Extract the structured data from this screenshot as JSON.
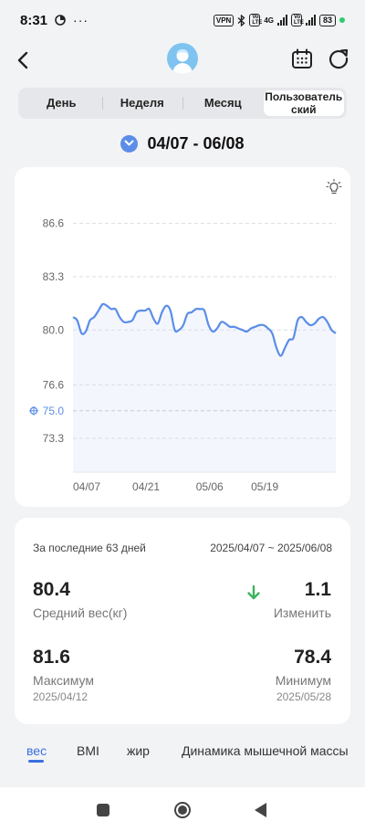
{
  "status_bar": {
    "time": "8:31",
    "vpn": "VPN",
    "net1": "4G",
    "battery": "83",
    "volte": "Vo LTE"
  },
  "header": {
    "icons": [
      "back-arrow-icon",
      "avatar-icon",
      "calendar-icon",
      "refresh-icon"
    ]
  },
  "tabs": [
    "День",
    "Неделя",
    "Месяц",
    "Пользователь ский"
  ],
  "active_tab": 3,
  "range": {
    "text": "04/07 - 06/08"
  },
  "chart_data": {
    "type": "line",
    "yticks": [
      "86.6",
      "83.3",
      "80.0",
      "76.6",
      "73.3"
    ],
    "goal_label": "75.0",
    "goal": 75.0,
    "xticks": [
      "04/07",
      "04/21",
      "05/06",
      "05/19"
    ],
    "ylim": [
      71.2,
      88.5
    ],
    "x": [
      0,
      1,
      2,
      3,
      4,
      5,
      6,
      7,
      8,
      9,
      10,
      11,
      12,
      13,
      14,
      15,
      16,
      17,
      18,
      19,
      20,
      21,
      22,
      23,
      24,
      25,
      26,
      27,
      28,
      29,
      30,
      31,
      32,
      33,
      34,
      35,
      36,
      37,
      38,
      39,
      40,
      41,
      42,
      43,
      44,
      45,
      46,
      47,
      48,
      49,
      50,
      51,
      52,
      53,
      54,
      55,
      56,
      57,
      58,
      59,
      60,
      61,
      62
    ],
    "values": [
      80.8,
      80.6,
      79.8,
      79.9,
      80.6,
      80.8,
      81.2,
      81.6,
      81.5,
      81.3,
      81.3,
      80.8,
      80.5,
      80.5,
      80.6,
      81.1,
      81.2,
      81.2,
      81.3,
      80.7,
      80.4,
      81.1,
      81.5,
      81.2,
      80.0,
      80.0,
      80.3,
      81.0,
      81.1,
      81.3,
      81.3,
      81.2,
      80.3,
      79.9,
      80.1,
      80.5,
      80.4,
      80.2,
      80.2,
      80.1,
      80.0,
      79.9,
      80.1,
      80.2,
      80.3,
      80.3,
      80.1,
      79.8,
      78.9,
      78.4,
      78.9,
      79.4,
      79.5,
      80.6,
      80.8,
      80.5,
      80.3,
      80.4,
      80.7,
      80.8,
      80.5,
      80.0,
      79.8
    ],
    "line_color": "#5b8de8",
    "fill_color": "#f3f6fd"
  },
  "stats": {
    "period_label": "За последние 63 дней",
    "period_dates": "2025/04/07 ~ 2025/06/08",
    "avg_value": "80.4",
    "avg_label": "Средний вес(кг)",
    "change_value": "1.1",
    "change_label": "Изменить",
    "change_color": "#3cb45c",
    "max_value": "81.6",
    "max_label": "Максимум",
    "max_date": "2025/04/12",
    "min_value": "78.4",
    "min_label": "Минимум",
    "min_date": "2025/05/28"
  },
  "bottom_tabs": [
    "вес",
    "BMI",
    "жир",
    "Динамика мышечной массы"
  ],
  "active_bottom_tab": 0,
  "nav": {
    "icons": [
      "recent-apps-icon",
      "home-icon",
      "back-icon"
    ]
  }
}
